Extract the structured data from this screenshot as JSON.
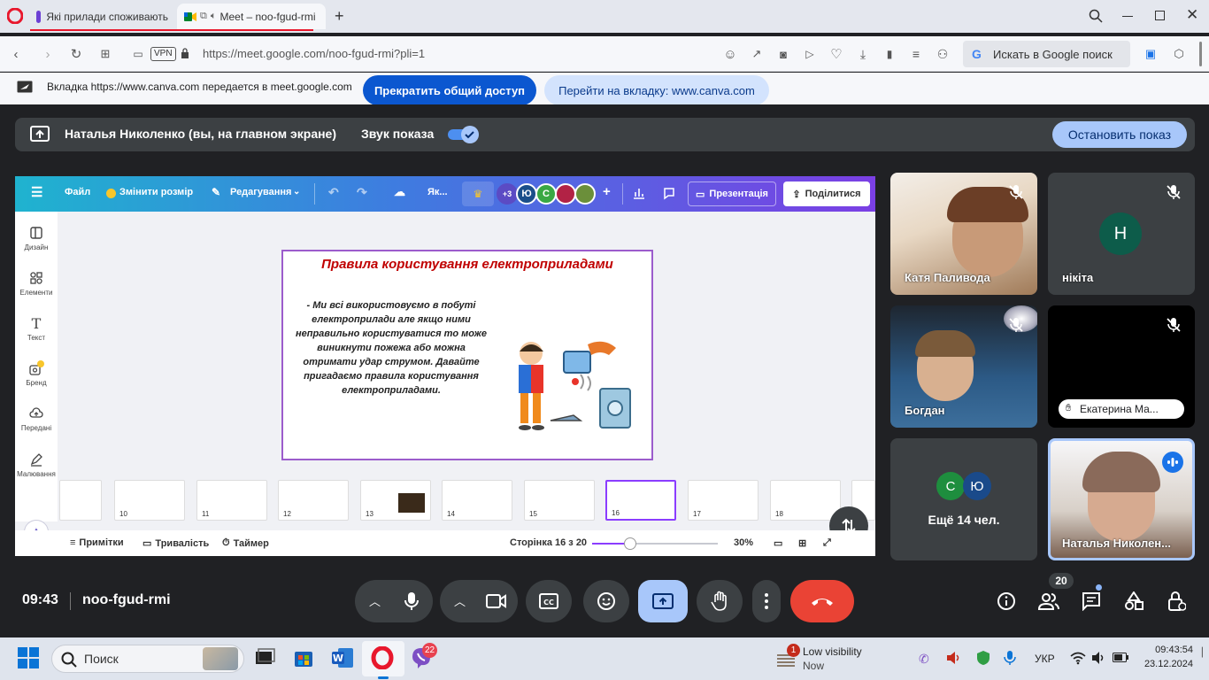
{
  "browser": {
    "tabs": [
      {
        "title": "Які прилади споживають"
      },
      {
        "title": "Meet – noo-fgud-rmi"
      }
    ],
    "url": "https://meet.google.com/noo-fgud-rmi?pli=1",
    "vpn_label": "VPN",
    "search_placeholder": "Искать в Google поиск"
  },
  "share_bar": {
    "message": "Вкладка https://www.canva.com передается в meet.google.com",
    "stop_label": "Прекратить общий доступ",
    "goto_label": "Перейти на вкладку: www.canva.com"
  },
  "meet": {
    "presenter_label": "Наталья Николенко (вы, на главном экране)",
    "audio_label": "Звук показа",
    "audio_enabled": true,
    "stop_presenting_label": "Остановить показ",
    "time": "09:43",
    "meeting_code": "noo-fgud-rmi",
    "people_count": "20",
    "participants": [
      {
        "name": "Катя Паливода",
        "muted": true
      },
      {
        "name": "нікіта",
        "initial": "Н",
        "avatar_color": "#0d5c4a",
        "muted": true
      },
      {
        "name": "Богдан",
        "muted": true
      },
      {
        "name": "Екатерина Ма...",
        "muted": true
      },
      {
        "name": "Ещё 14 чел.",
        "initials": [
          "С",
          "Ю"
        ]
      },
      {
        "name": "Наталья Николен...",
        "speaking": true
      }
    ]
  },
  "canva": {
    "menu": {
      "file": "Файл",
      "resize": "Змінити розмір",
      "editing": "Редагування",
      "short": "Як...",
      "more_count": "+3",
      "avatar_ju": "Ю",
      "avatar_s": "С",
      "present": "Презентація",
      "share": "Поділитися"
    },
    "sidebar": [
      {
        "label": "Дизайн",
        "icon": "design-icon"
      },
      {
        "label": "Елементи",
        "icon": "elements-icon"
      },
      {
        "label": "Текст",
        "icon": "text-icon"
      },
      {
        "label": "Бренд",
        "icon": "brand-icon"
      },
      {
        "label": "Передані",
        "icon": "uploads-icon"
      },
      {
        "label": "Малювання",
        "icon": "draw-icon"
      }
    ],
    "slide": {
      "title": "Правила користування електроприладами",
      "body": "- Ми всі використовуємо в побуті електроприлади але якщо ними неправильно користуватися то може виникнути пожежа або можна отримати удар струмом. Давайте пригадаємо правила користування електроприладами."
    },
    "thumbnails": [
      "10",
      "11",
      "12",
      "13",
      "14",
      "15",
      "16",
      "17",
      "18"
    ],
    "selected_thumbnail": "16",
    "footer": {
      "notes": "Примітки",
      "duration": "Тривалість",
      "timer": "Таймер",
      "page": "Сторінка 16 з 20",
      "zoom": "30%",
      "zoom_fraction": 0.3
    }
  },
  "taskbar": {
    "search": "Поиск",
    "chat_badge": "22",
    "weather_title": "Low visibility",
    "weather_sub": "Now",
    "weather_badge": "1",
    "lang": "УКР",
    "clock_time": "09:43:54",
    "clock_date": "23.12.2024"
  }
}
